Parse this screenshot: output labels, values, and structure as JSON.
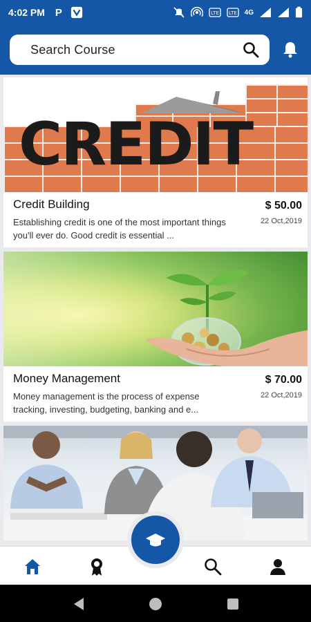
{
  "status_bar": {
    "time": "4:02 PM",
    "app_icon_1": "P",
    "network": "4G",
    "icons": [
      "muted-icon",
      "hotspot-icon",
      "volte-icon",
      "volte-icon",
      "signal-icon",
      "signal-icon",
      "battery-icon"
    ]
  },
  "search": {
    "placeholder": "Search Course"
  },
  "courses": [
    {
      "title": "Credit Building",
      "price": "$ 50.00",
      "date": "22 Oct,2019",
      "description": "Establishing credit is one of the most important things you'll ever do. Good credit is essential ...",
      "image_text": "CREDIT"
    },
    {
      "title": "Money Management",
      "price": "$ 70.00",
      "date": "22 Oct,2019",
      "description": "Money management is the process of expense tracking, investing, budgeting, banking and e..."
    },
    {
      "title": "",
      "price": "",
      "date": "",
      "description": ""
    }
  ],
  "bottom_nav": {
    "items": [
      "home-icon",
      "award-icon",
      "courses-icon",
      "search-icon",
      "profile-icon"
    ],
    "active": "home-icon"
  },
  "colors": {
    "brand": "#1357a6",
    "background": "#e9e9ee",
    "brick": "#e07a4d"
  }
}
